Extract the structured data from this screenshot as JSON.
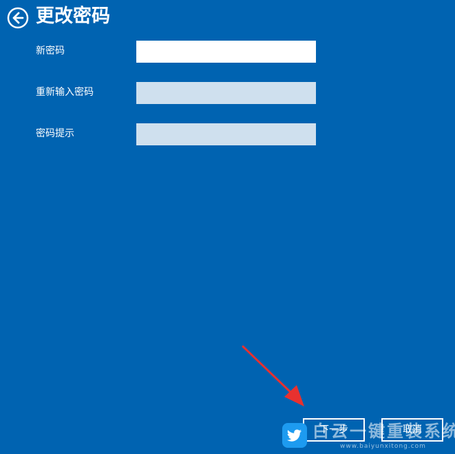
{
  "header": {
    "back_icon": "arrow-left-circle-icon",
    "title": "更改密码"
  },
  "form": {
    "fields": [
      {
        "label": "新密码",
        "value": "",
        "state": "active"
      },
      {
        "label": "重新输入密码",
        "value": "",
        "state": "inactive"
      },
      {
        "label": "密码提示",
        "value": "",
        "state": "inactive"
      }
    ]
  },
  "buttons": {
    "next_label": "下一步",
    "cancel_label": "取消"
  },
  "watermark": {
    "icon": "twitter-bird-icon",
    "text": "白云一键重装系统",
    "url_text": "www.baiyunxitong.com"
  },
  "colors": {
    "background": "#0063b1",
    "active_input": "#ffffff",
    "inactive_input": "#cfe0ee",
    "annotation_arrow": "#e8312f",
    "watermark_badge": "#1d9bf0"
  }
}
